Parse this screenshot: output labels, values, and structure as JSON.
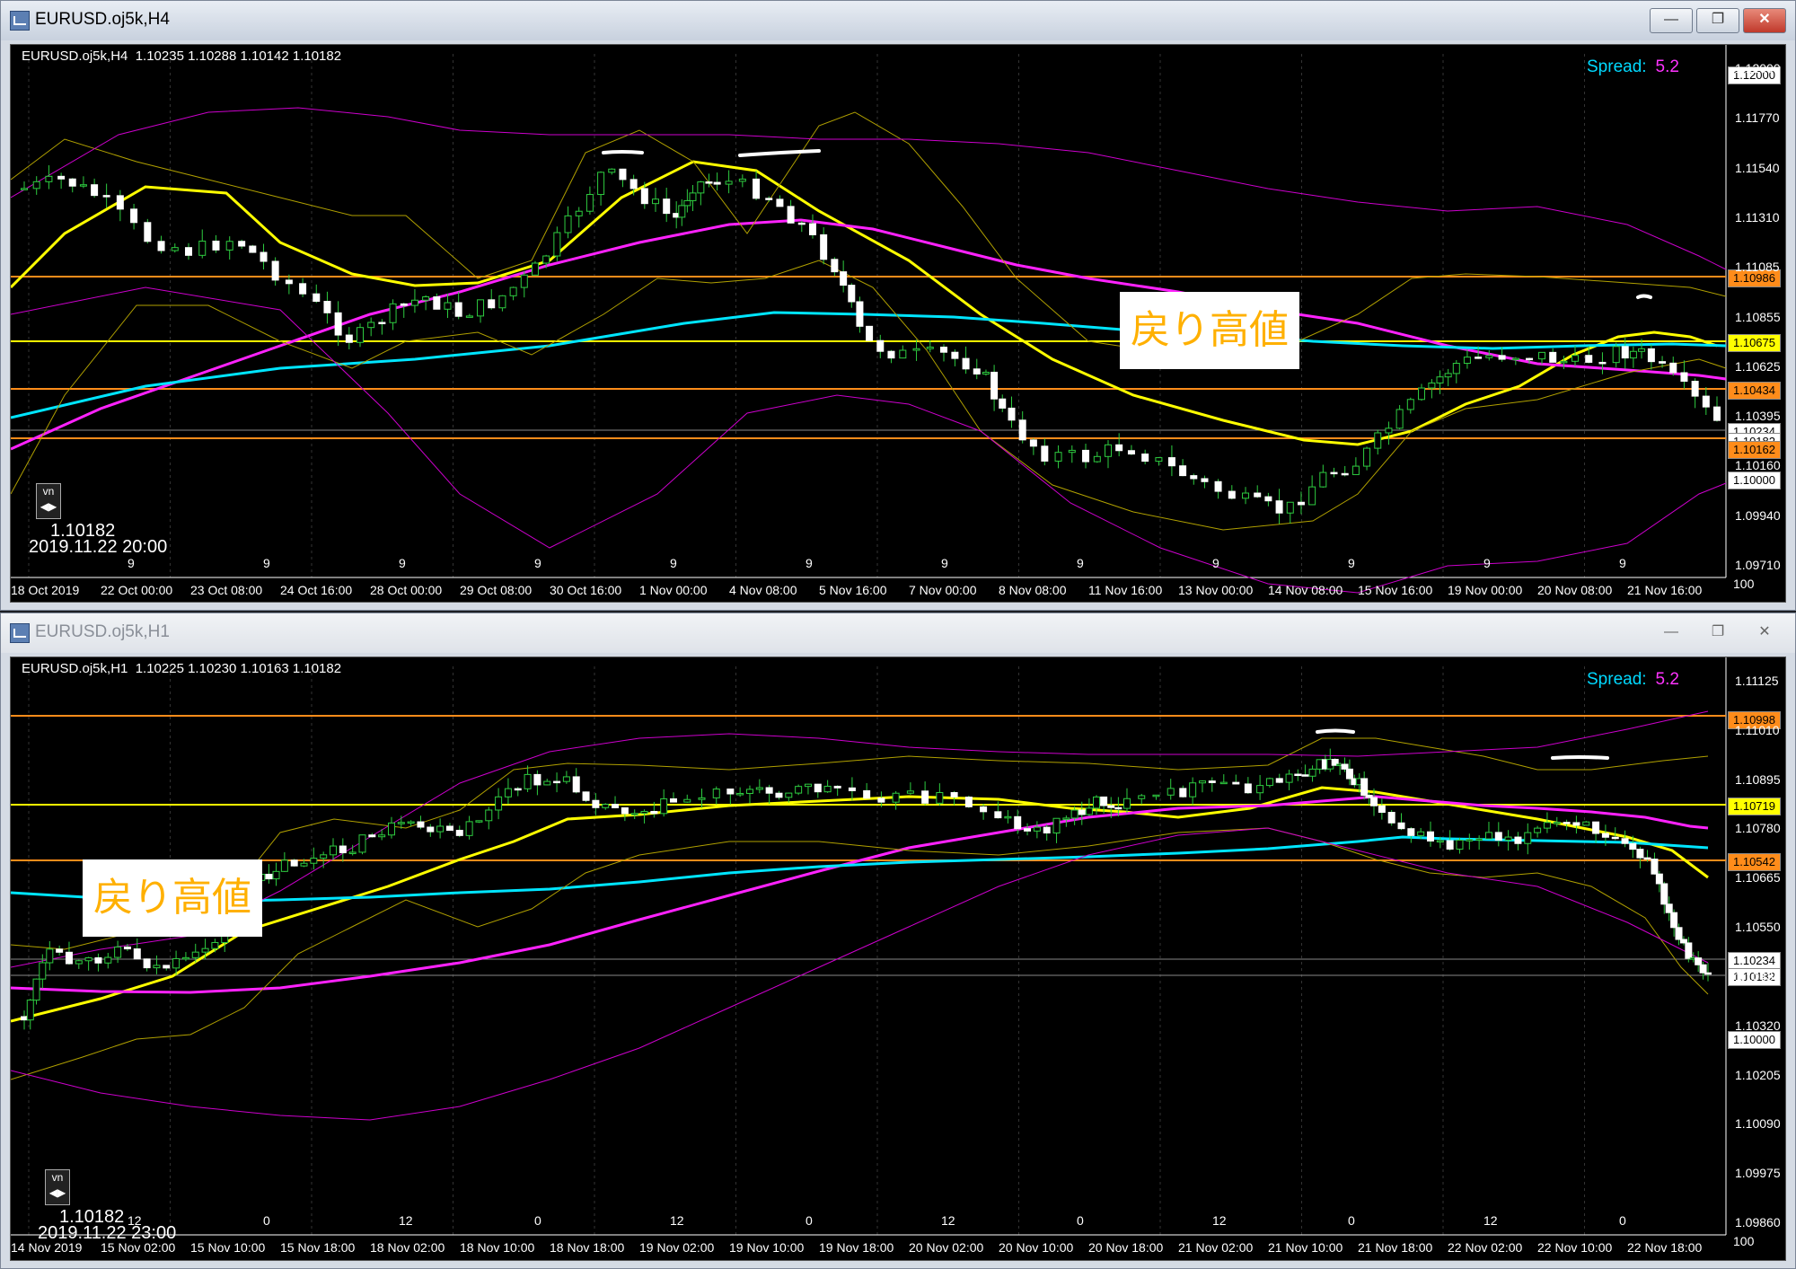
{
  "window1": {
    "title": "EURUSD.oj5k,H4",
    "info": "EURUSD.oj5k,H4  1.10235 1.10288 1.10142 1.10182",
    "spread_label": "Spread:",
    "spread_value": "5.2",
    "annotation": "戻り高値",
    "timestamp": "2019.11.22 20:00",
    "last_price": "1.10182",
    "nav_label": "vn",
    "price_ticks": [
      "1.12000",
      "1.11770",
      "1.11540",
      "1.11310",
      "1.11085",
      "1.10855",
      "1.10625",
      "1.10395",
      "1.10160",
      "1.09940",
      "1.09710"
    ],
    "price_tags": [
      {
        "text": "1.12000",
        "color": "#ffffff"
      },
      {
        "text": "1.10986",
        "color": "#ff8c1a"
      },
      {
        "text": "1.10675",
        "color": "#ffff00"
      },
      {
        "text": "1.10434",
        "color": "#ff8c1a"
      },
      {
        "text": "1.10234",
        "color": "#ffffff"
      },
      {
        "text": "1.10182",
        "color": "#ffffff"
      },
      {
        "text": "1.10162",
        "color": "#ff8c1a"
      },
      {
        "text": "1.10000",
        "color": "#ffffff"
      }
    ],
    "hour_marks": [
      "9",
      "9",
      "9",
      "9",
      "9",
      "9",
      "9",
      "9",
      "9",
      "9",
      "9",
      "9"
    ],
    "time_labels": [
      "18 Oct 2019",
      "22 Oct 00:00",
      "23 Oct 08:00",
      "24 Oct 16:00",
      "28 Oct 00:00",
      "29 Oct 08:00",
      "30 Oct 16:00",
      "1 Nov 00:00",
      "4 Nov 08:00",
      "5 Nov 16:00",
      "7 Nov 00:00",
      "8 Nov 08:00",
      "11 Nov 16:00",
      "13 Nov 00:00",
      "14 Nov 08:00",
      "15 Nov 16:00",
      "19 Nov 00:00",
      "20 Nov 08:00",
      "21 Nov 16:00"
    ],
    "corner_label": "100"
  },
  "window2": {
    "title": "EURUSD.oj5k,H1",
    "info": "EURUSD.oj5k,H1  1.10225 1.10230 1.10163 1.10182",
    "spread_label": "Spread:",
    "spread_value": "5.2",
    "annotation": "戻り高値",
    "timestamp": "2019.11.22 23:00",
    "last_price": "1.10182",
    "nav_label": "vn",
    "price_ticks": [
      "1.11125",
      "1.11010",
      "1.10895",
      "1.10780",
      "1.10665",
      "1.10550",
      "1.10435",
      "1.10320",
      "1.10205",
      "1.10090",
      "1.09975",
      "1.09860"
    ],
    "price_tags": [
      {
        "text": "1.10998",
        "color": "#ff8c1a"
      },
      {
        "text": "1.10719",
        "color": "#ffff00"
      },
      {
        "text": "1.10542",
        "color": "#ff8c1a"
      },
      {
        "text": "1.10234",
        "color": "#ffffff"
      },
      {
        "text": "1.10182",
        "color": "#ffffff"
      },
      {
        "text": "1.10000",
        "color": "#ffffff"
      }
    ],
    "hour_marks": [
      "12",
      "0",
      "12",
      "0",
      "12",
      "0",
      "12",
      "0",
      "12",
      "0",
      "12",
      "0"
    ],
    "time_labels": [
      "14 Nov 2019",
      "15 Nov 02:00",
      "15 Nov 10:00",
      "15 Nov 18:00",
      "18 Nov 02:00",
      "18 Nov 10:00",
      "18 Nov 18:00",
      "19 Nov 02:00",
      "19 Nov 10:00",
      "19 Nov 18:00",
      "20 Nov 02:00",
      "20 Nov 10:00",
      "20 Nov 18:00",
      "21 Nov 02:00",
      "21 Nov 10:00",
      "21 Nov 18:00",
      "22 Nov 02:00",
      "22 Nov 10:00",
      "22 Nov 18:00"
    ],
    "corner_label": "100"
  }
}
